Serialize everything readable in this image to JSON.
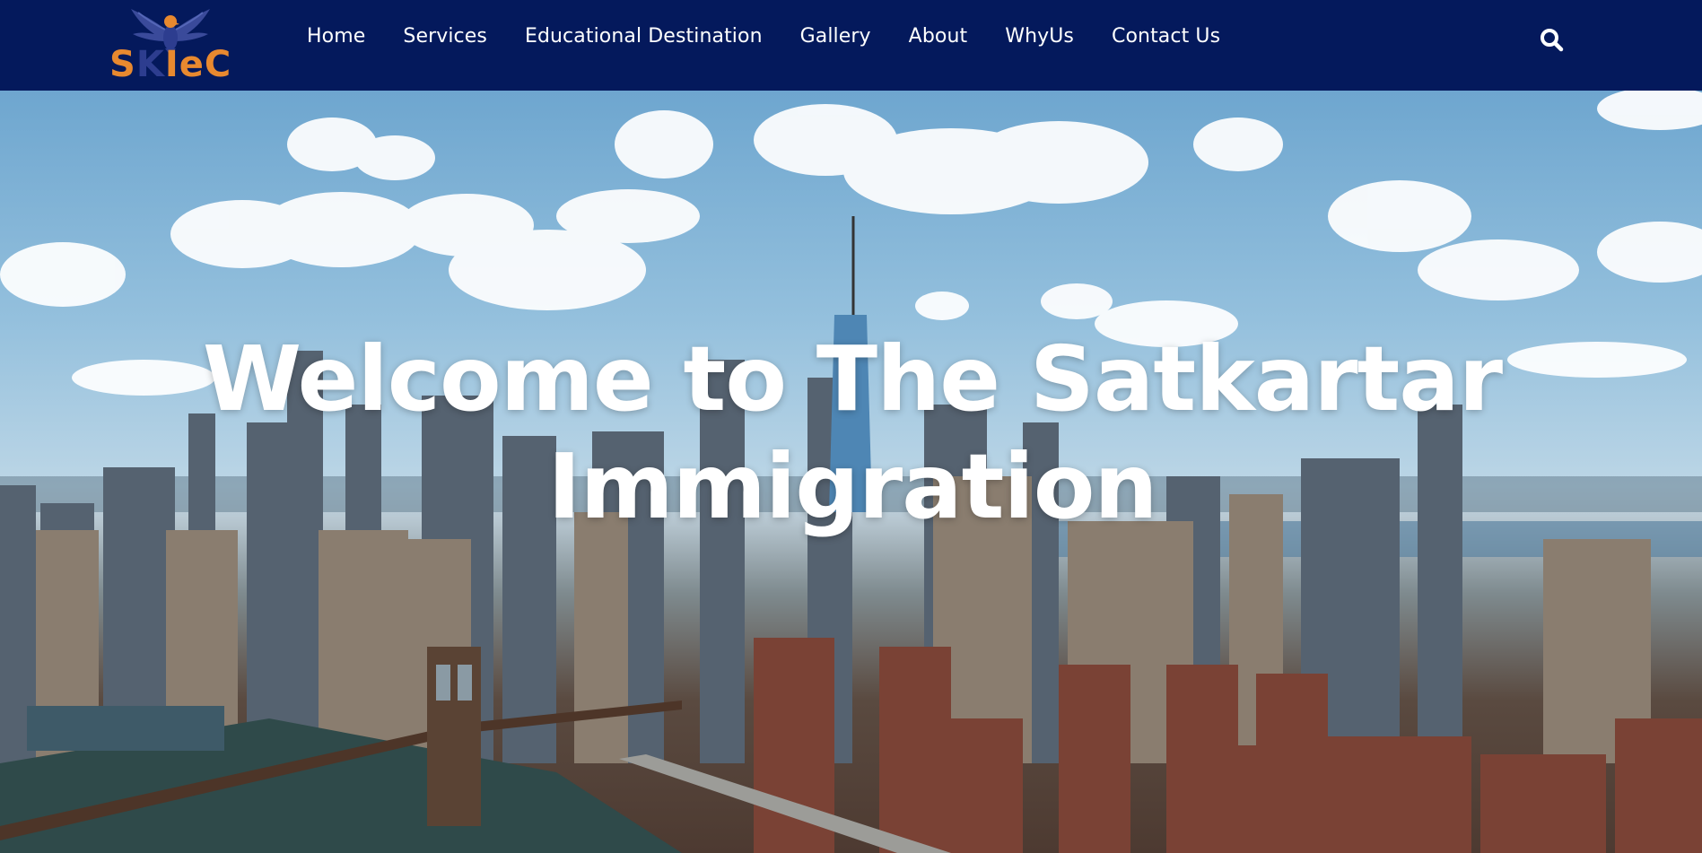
{
  "header": {
    "logo": {
      "letters": [
        "S",
        "K",
        "Ie",
        "C"
      ],
      "icon": "eagle-icon",
      "brand_color": "#e8892f",
      "accent_color": "#2d3d8f"
    },
    "nav": [
      {
        "label": "Home"
      },
      {
        "label": "Services"
      },
      {
        "label": "Educational Destination"
      },
      {
        "label": "Gallery"
      },
      {
        "label": "About"
      },
      {
        "label": "WhyUs"
      },
      {
        "label": "Contact Us"
      }
    ],
    "search_icon": "search-icon",
    "background": "#04195c"
  },
  "hero": {
    "title_line1": "Welcome to The Satkartar",
    "title_line2": "Immigration",
    "background_image": "city-skyline-with-bridge"
  }
}
